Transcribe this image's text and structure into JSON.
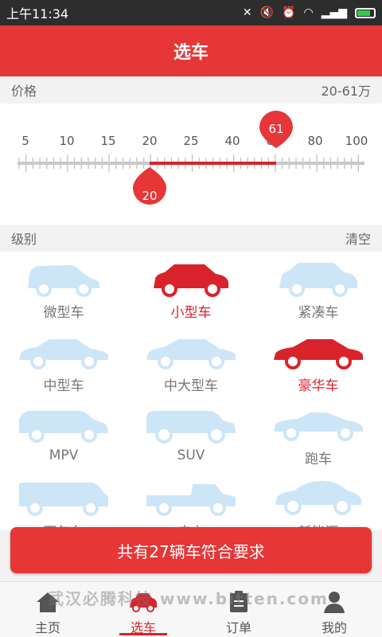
{
  "status_bar": {
    "time": "上午11:34",
    "icons": [
      "signal-off-icon",
      "mute-icon",
      "alarm-icon",
      "wifi-icon",
      "cell-signal-icon",
      "battery-icon"
    ]
  },
  "header": {
    "title": "选车"
  },
  "price": {
    "label": "价格",
    "range_text": "20-61万",
    "ticks": [
      "5",
      "10",
      "15",
      "20",
      "25",
      "40",
      "60",
      "80",
      "100"
    ],
    "min_value": "20",
    "max_value": "61"
  },
  "level": {
    "label": "级别",
    "clear": "清空",
    "items": [
      {
        "label": "微型车",
        "selected": false,
        "icon": "mini-car-icon"
      },
      {
        "label": "小型车",
        "selected": true,
        "icon": "small-car-icon"
      },
      {
        "label": "紧凑车",
        "selected": false,
        "icon": "compact-car-icon"
      },
      {
        "label": "中型车",
        "selected": false,
        "icon": "midsize-car-icon"
      },
      {
        "label": "中大型车",
        "selected": false,
        "icon": "large-car-icon"
      },
      {
        "label": "豪华车",
        "selected": true,
        "icon": "luxury-car-icon"
      },
      {
        "label": "MPV",
        "selected": false,
        "icon": "mpv-icon"
      },
      {
        "label": "SUV",
        "selected": false,
        "icon": "suv-icon"
      },
      {
        "label": "跑车",
        "selected": false,
        "icon": "sports-car-icon"
      },
      {
        "label": "面包车",
        "selected": false,
        "icon": "van-icon"
      },
      {
        "label": "皮卡",
        "selected": false,
        "icon": "pickup-icon"
      },
      {
        "label": "新能源",
        "selected": false,
        "icon": "new-energy-car-icon"
      }
    ]
  },
  "cta": {
    "label": "共有27辆车符合要求"
  },
  "tabs": [
    {
      "label": "主页",
      "icon": "home-icon",
      "active": false
    },
    {
      "label": "选车",
      "icon": "car-select-icon",
      "active": true
    },
    {
      "label": "订单",
      "icon": "order-icon",
      "active": false
    },
    {
      "label": "我的",
      "icon": "profile-icon",
      "active": false
    }
  ],
  "watermark": "武汉必腾科技 www.bitten.com",
  "colors": {
    "accent": "#e63637",
    "selected_icon": "#d9232b",
    "unselected_icon": "#cde6f7"
  }
}
